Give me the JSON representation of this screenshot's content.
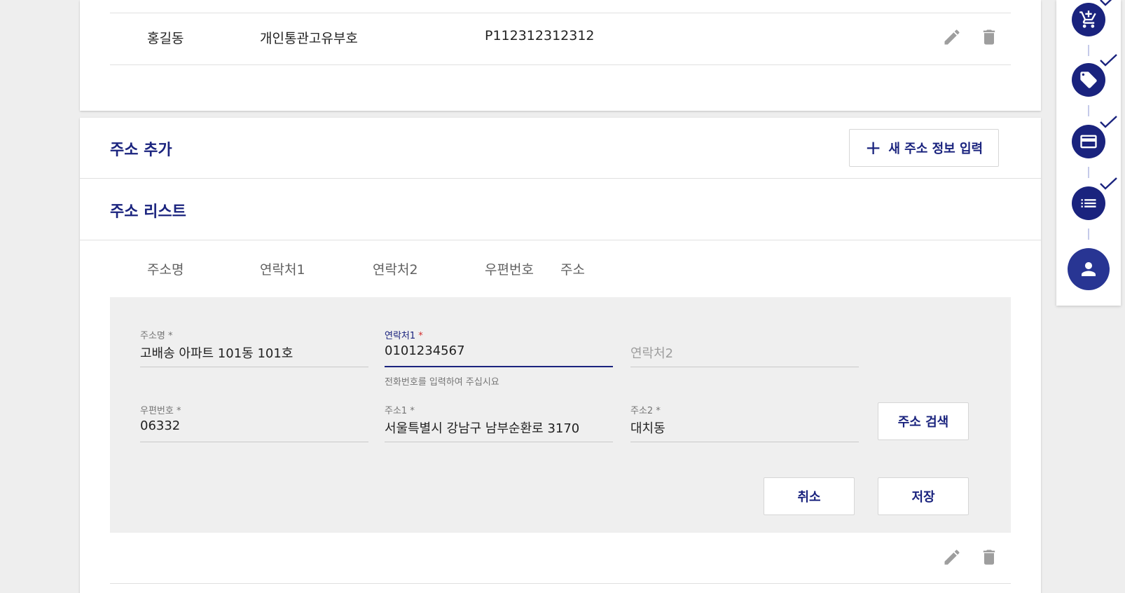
{
  "top_table": {
    "row": {
      "name": "홍길동",
      "type": "개인통관고유부호",
      "number": "P112312312312"
    }
  },
  "add_section": {
    "title": "주소 추가",
    "new_button_label": "새 주소 정보 입력"
  },
  "list_section": {
    "title": "주소 리스트",
    "columns": [
      "주소명",
      "연락처1",
      "연락처2",
      "우편번호",
      "주소"
    ]
  },
  "edit_form": {
    "address_name": {
      "label": "주소명",
      "required": "*",
      "value": "고배송 아파트 101동 101호"
    },
    "contact1": {
      "label": "연락처1",
      "required": "*",
      "value": "0101234567",
      "hint": "전화번호를 입력하여 주십시요"
    },
    "contact2": {
      "placeholder": "연락처2"
    },
    "zipcode": {
      "label": "우편번호",
      "required": "*",
      "value": "06332"
    },
    "address1": {
      "label": "주소1",
      "required": "*",
      "value": "서울특별시 강남구 남부순환로 3170"
    },
    "address2": {
      "label": "주소2",
      "required": "*",
      "value": "대치동"
    },
    "search_button": "주소 검색",
    "cancel_button": "취소",
    "save_button": "저장"
  },
  "icons": {
    "edit": "pencil-icon",
    "delete": "trash-icon",
    "add": "plus-icon",
    "steps": [
      "cart-add-icon",
      "tag-icon",
      "credit-card-icon",
      "list-icon",
      "person-icon"
    ],
    "step_done": "check-icon"
  },
  "colors": {
    "primary": "#1a237e",
    "required": "#d32f2f",
    "panel_bg": "#efefef",
    "page_bg": "#eeeeee"
  }
}
